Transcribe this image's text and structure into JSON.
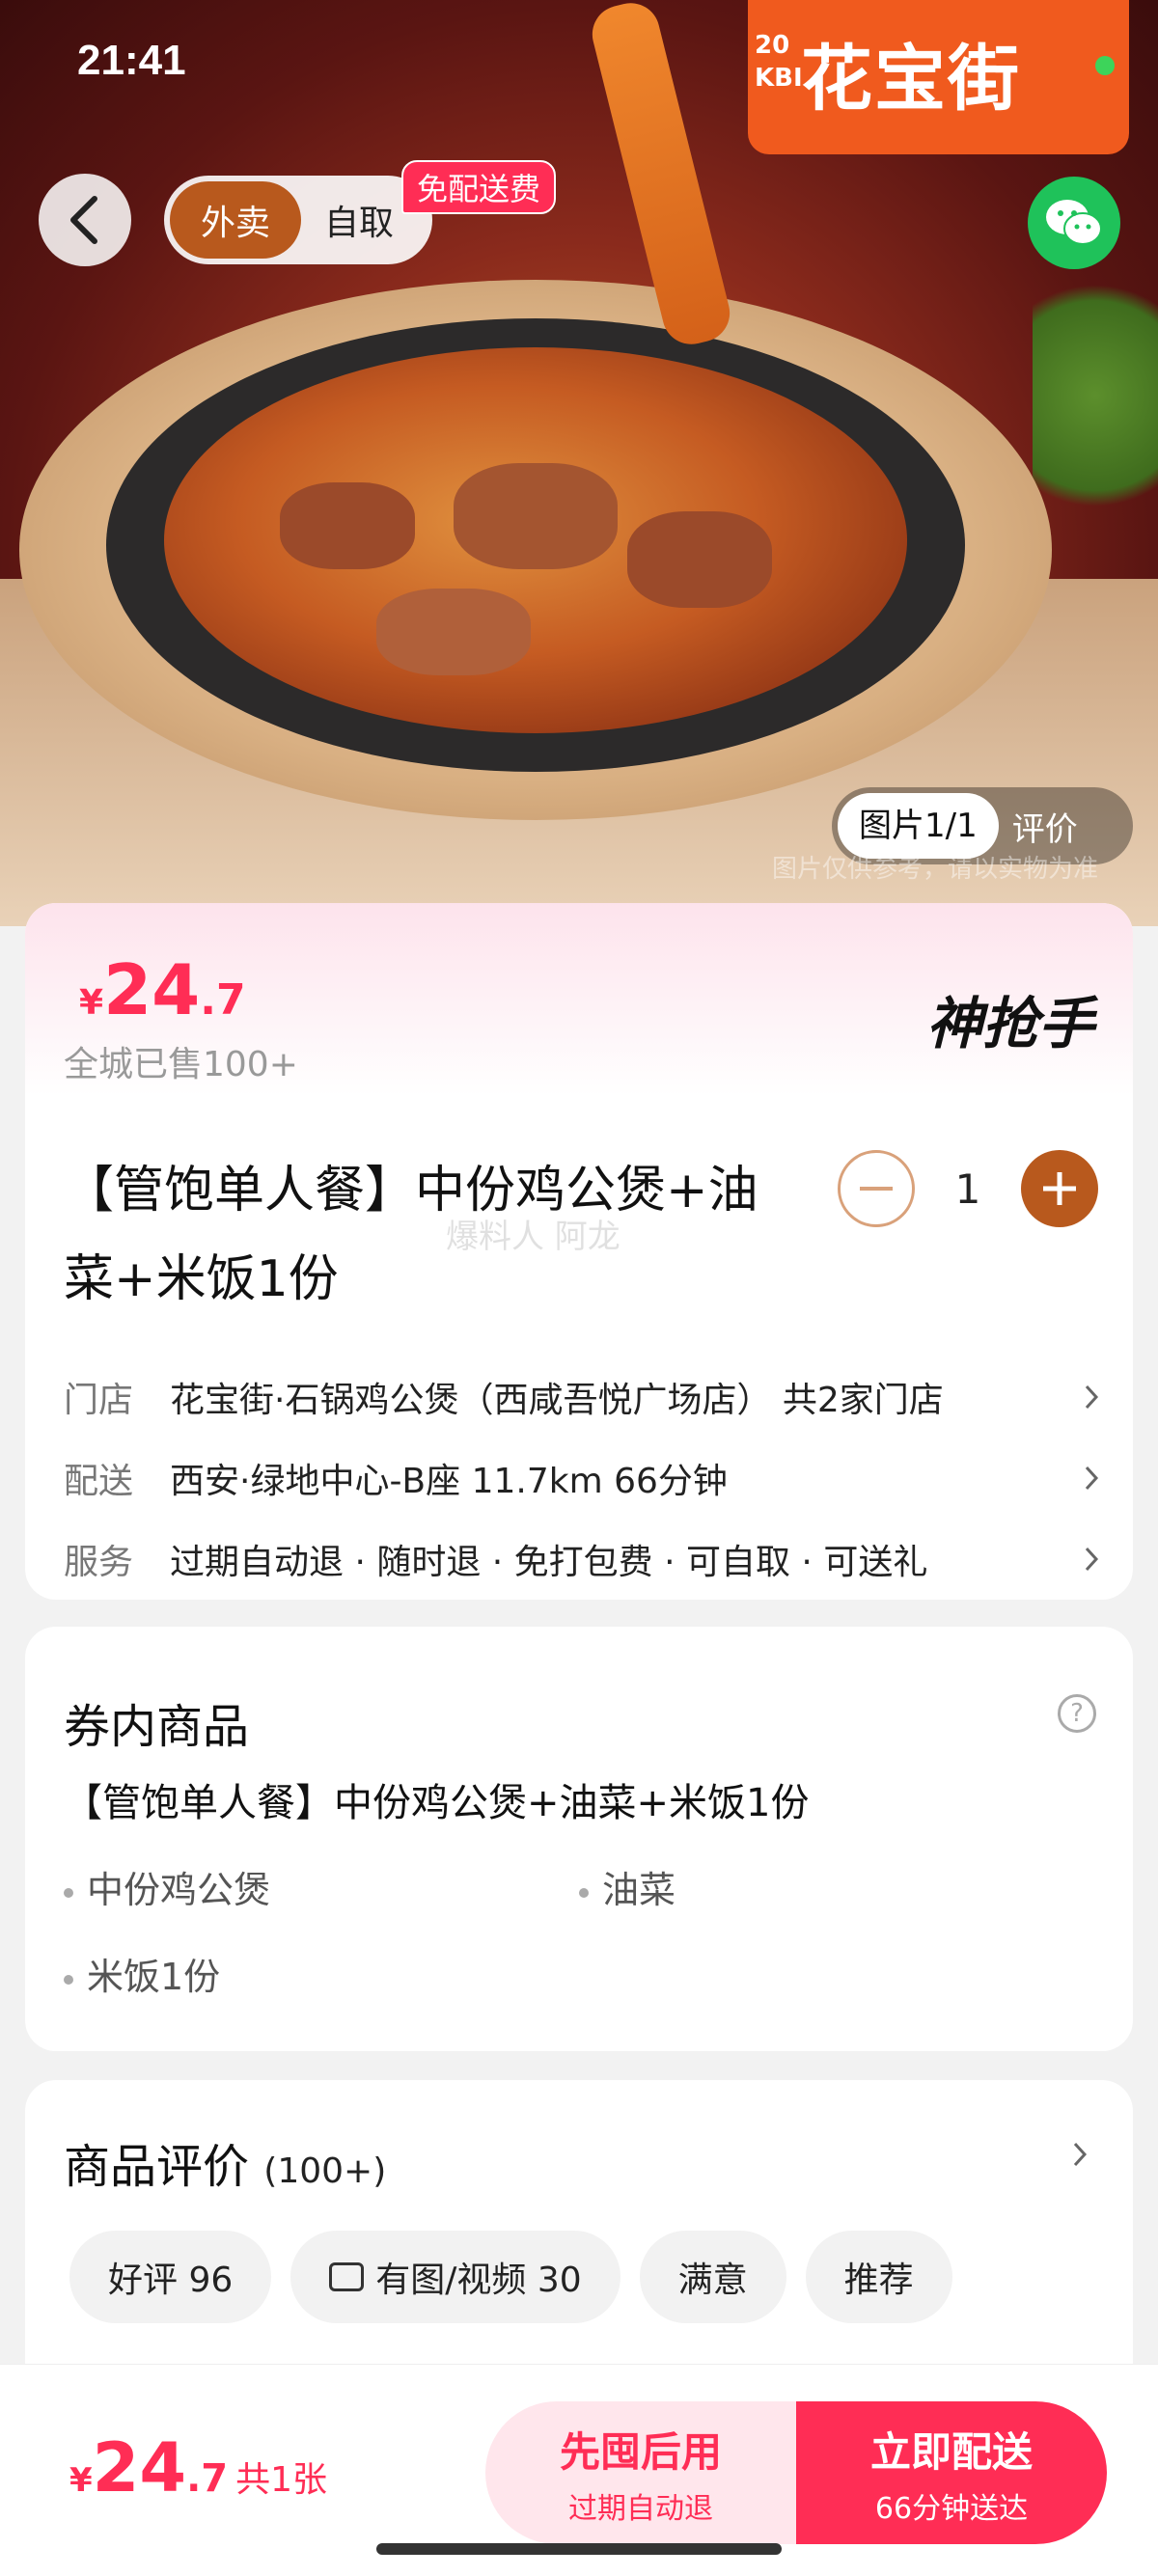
{
  "status": {
    "time": "21:41"
  },
  "brand": {
    "year": "20\nKBI",
    "name": "花宝街"
  },
  "header": {
    "mode_delivery": "外卖",
    "mode_pickup": "自取",
    "free_delivery_badge": "免配送费"
  },
  "gallery": {
    "tab_pictures": "图片1/1",
    "tab_reviews": "评价",
    "watermark": "图片仅供参考，请以实物为准"
  },
  "product": {
    "currency": "¥",
    "price_int": "24",
    "price_dec": ".7",
    "sold": "全城已售100+",
    "promo_label": "神抢手",
    "title": "【管饱单人餐】中份鸡公煲+油菜+米饭1份",
    "overlay_watermark": "爆料人 阿龙",
    "quantity": "1",
    "rows": [
      {
        "key": "门店",
        "value": "花宝街·石锅鸡公煲（西咸吾悦广场店）   共2家门店"
      },
      {
        "key": "配送",
        "value": "西安·绿地中心-B座   11.7km   66分钟"
      },
      {
        "key": "服务",
        "value": "过期自动退 · 随时退 · 免打包费 · 可自取 · 可送礼"
      }
    ]
  },
  "voucher": {
    "title": "券内商品",
    "combo": "【管饱单人餐】中份鸡公煲+油菜+米饭1份",
    "items": [
      "中份鸡公煲",
      "油菜",
      "米饭1份"
    ]
  },
  "reviews": {
    "title": "商品评价",
    "count": "(100+)",
    "chips": [
      "好评 96",
      "有图/视频 30",
      "满意",
      "推荐"
    ]
  },
  "bottom": {
    "currency": "¥",
    "price_int": "24",
    "price_dec": ".7",
    "qty": "共1张",
    "btn_left_main": "先囤后用",
    "btn_left_sub": "过期自动退",
    "btn_right_main": "立即配送",
    "btn_right_sub": "66分钟送达"
  },
  "colors": {
    "accent": "#ff2d55",
    "brown": "#b8591d",
    "wechat": "#1fc25a"
  }
}
